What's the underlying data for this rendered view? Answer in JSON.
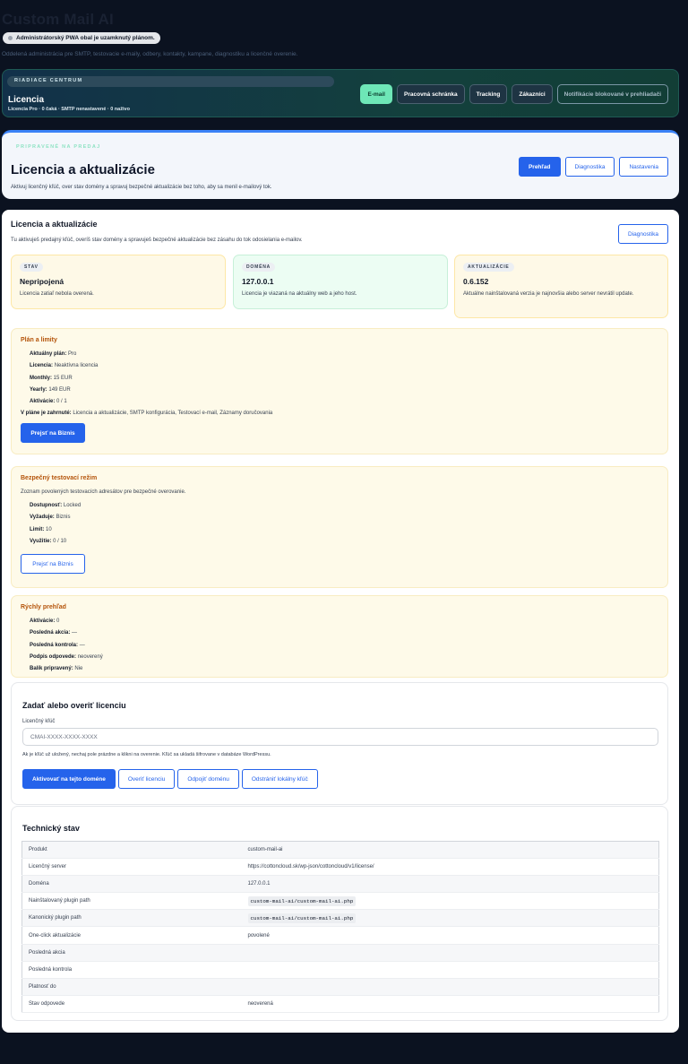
{
  "app": {
    "title": "Custom Mail AI",
    "pwa_notice": "Administrátorský PWA obal je uzamknutý plánom.",
    "subtitle": "Oddelená administrácia pre SMTP, testovacie e-maily, odbery, kontakty, kampane, diagnostiku a licenčné overenie."
  },
  "control_center": {
    "badge": "RIADIACE CENTRUM",
    "title": "Licencia",
    "meta": "Licencia Pro · 0 čaká · SMTP nenastavené · 0 naživo",
    "nav": [
      {
        "label": "E-mail",
        "state": "active"
      },
      {
        "label": "Pracovná schránka",
        "state": "default"
      },
      {
        "label": "Tracking",
        "state": "default"
      },
      {
        "label": "Zákazníci",
        "state": "default"
      },
      {
        "label": "Notifikácie blokované v prehliadači",
        "state": "muted"
      }
    ]
  },
  "hero": {
    "badge": "PRIPRAVENÉ NA PREDAJ",
    "title": "Licencia a aktualizácie",
    "description": "Aktivuj licenčný kľúč, over stav domény a spravuj bezpečné aktualizácie bez toho, aby sa menil e-mailový tok.",
    "actions": [
      "Prehľad",
      "Diagnostika",
      "Nastavenia"
    ]
  },
  "main": {
    "title": "Licencia a aktualizácie",
    "description": "Tu aktivuješ predajný kľúč, overíš stav domény a spravuješ bezpečné aktualizácie bez zásahu do tok odosielania e-mailov.",
    "diagnostics_label": "Diagnostika"
  },
  "stats": [
    {
      "label": "STAV",
      "value": "Nepripojená",
      "note": "Licencia zatiaľ nebola overená.",
      "tone": "warn"
    },
    {
      "label": "DOMÉNA",
      "value": "127.0.0.1",
      "note": "Licencia je viazaná na aktuálny web a jeho host.",
      "tone": "ok"
    },
    {
      "label": "AKTUALIZÁCIE",
      "value": "0.6.152",
      "note": "Aktuálne nainštalovaná verzia je najnovšia alebo server nevrátil update.",
      "tone": "warn"
    }
  ],
  "plan": {
    "title": "Plán a limity",
    "rows": [
      {
        "k": "Aktuálny plán:",
        "v": "Pro"
      },
      {
        "k": "Licencia:",
        "v": "Neaktívna licencia"
      },
      {
        "k": "Monthly:",
        "v": "15 EUR"
      },
      {
        "k": "Yearly:",
        "v": "149 EUR"
      },
      {
        "k": "Aktivácie:",
        "v": "0 / 1"
      }
    ],
    "includes_label": "V pláne je zahrnuté:",
    "includes_value": "Licencia a aktualizácie, SMTP konfigurácia, Testovací e-mail, Záznamy doručovania",
    "button": "Prejsť na Biznis"
  },
  "safe_mode": {
    "title": "Bezpečný testovací režim",
    "intro": "Zoznam povolených testovacích adresátov pre bezpečné overovanie.",
    "rows": [
      {
        "k": "Dostupnosť:",
        "v": "Locked"
      },
      {
        "k": "Vyžaduje:",
        "v": "Biznis"
      },
      {
        "k": "Limit:",
        "v": "10"
      },
      {
        "k": "Využitie:",
        "v": "0 / 10"
      }
    ],
    "button": "Prejsť na Biznis"
  },
  "quick": {
    "title": "Rýchly prehľad",
    "rows": [
      {
        "k": "Aktivácie:",
        "v": "0"
      },
      {
        "k": "Posledná akcia:",
        "v": "—"
      },
      {
        "k": "Posledná kontrola:",
        "v": "—"
      },
      {
        "k": "Podpis odpovede:",
        "v": "neoverený"
      },
      {
        "k": "Balík pripravený:",
        "v": "Nie"
      }
    ]
  },
  "license_form": {
    "title": "Zadať alebo overiť licenciu",
    "label": "Licenčný kľúč",
    "placeholder": "CMAI-XXXX-XXXX-XXXX",
    "value": "",
    "help": "Ak je kľúč už uložený, nechaj pole prázdne a klikni na overenie. Kľúč sa ukladá šifrovane v databáze WordPressu.",
    "actions": [
      "Aktivovať na tejto doméne",
      "Overiť licenciu",
      "Odpojiť doménu",
      "Odstrániť lokálny kľúč"
    ]
  },
  "tech": {
    "title": "Technický stav",
    "rows": [
      {
        "k": "Produkt",
        "v": "custom-mail-ai",
        "code": false
      },
      {
        "k": "Licenčný server",
        "v": "https://cottoncloud.sk/wp-json/cottoncloud/v1/license/",
        "code": false
      },
      {
        "k": "Doména",
        "v": "127.0.0.1",
        "code": false
      },
      {
        "k": "Nainštalovaný plugin path",
        "v": "custom-mail-ai/custom-mail-ai.php",
        "code": true
      },
      {
        "k": "Kanonický plugin path",
        "v": "custom-mail-ai/custom-mail-ai.php",
        "code": true
      },
      {
        "k": "One-click aktualizácie",
        "v": "povolené",
        "code": false
      },
      {
        "k": "Posledná akcia",
        "v": "",
        "code": false
      },
      {
        "k": "Posledná kontrola",
        "v": "",
        "code": false
      },
      {
        "k": "Platnosť do",
        "v": "",
        "code": false
      },
      {
        "k": "Stav odpovede",
        "v": "neoverená",
        "code": false
      }
    ]
  }
}
